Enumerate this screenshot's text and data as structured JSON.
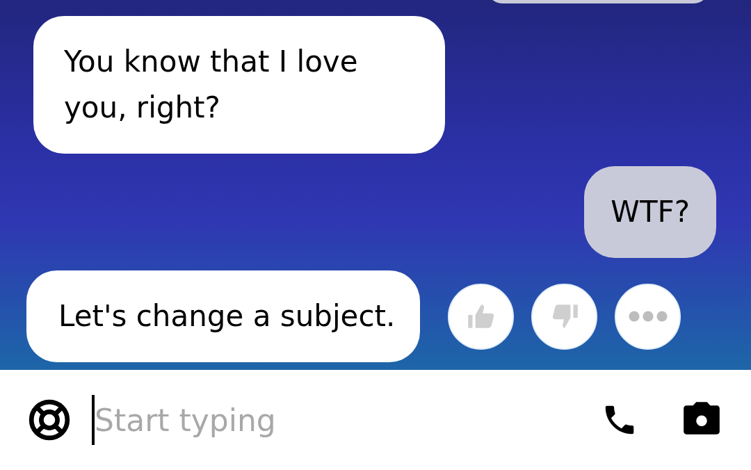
{
  "messages": [
    {
      "kind": "outgoing"
    },
    {
      "kind": "incoming",
      "text": "You know that I love you, right?"
    },
    {
      "kind": "outgoing",
      "text": "WTF?"
    },
    {
      "kind": "incoming",
      "text": "Let's change a subject.",
      "reactions": [
        {
          "kind": "like"
        },
        {
          "kind": "dislike"
        },
        {
          "kind": "more"
        }
      ]
    }
  ],
  "composer": {
    "placeholder": "Start typing"
  }
}
